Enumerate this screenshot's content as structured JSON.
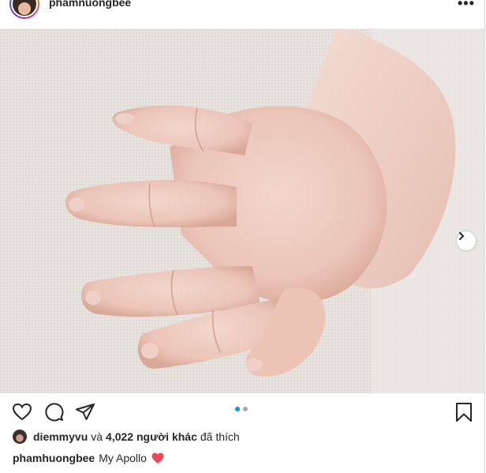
{
  "post": {
    "username": "phamnuongbee",
    "menu_label": "•••"
  },
  "photo": {
    "description_icon": "baby-hand-photo",
    "carousel_total": 2,
    "carousel_index": 1
  },
  "actions": {
    "like_icon": "heart-icon",
    "comment_icon": "comment-icon",
    "share_icon": "send-icon",
    "save_icon": "bookmark-icon"
  },
  "likes": {
    "user": "diemmyvu",
    "connector": "và",
    "count_text": "4,022 người khác",
    "suffix": "đã thích"
  },
  "caption": {
    "username": "phamhuongbee",
    "text": "My Apollo",
    "emoji_color": "#ed4956"
  },
  "colors": {
    "accent": "#0095f6",
    "text": "#262626",
    "border": "#dbdbdb"
  }
}
